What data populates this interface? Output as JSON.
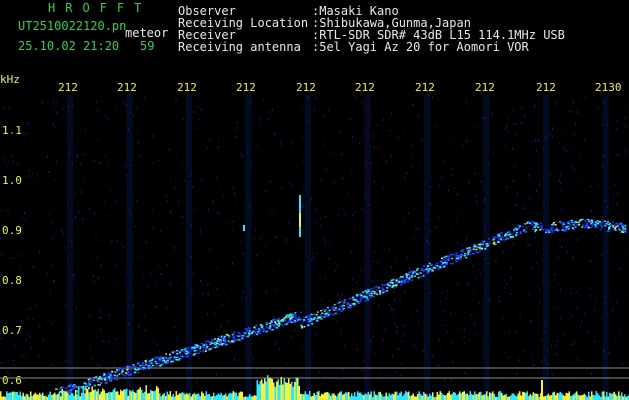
{
  "header": {
    "brand": "HROFFT",
    "filename": "UT2510022120.pn",
    "satellite_label": "meteor",
    "datetime": "25.10.02 21:20",
    "count": "59"
  },
  "meta": {
    "labels": [
      "Observer",
      "Receiving Location",
      "Receiver",
      "Receiving antenna"
    ],
    "values": [
      ":Masaki Kano",
      ":Shibukawa,Gunma,Japan",
      ":RTL-SDR SDR# 43dB L15 114.1MHz USB",
      ":5el Yagi Az 20 for Aomori VOR"
    ]
  },
  "axis": {
    "unit_label": "kHz",
    "time_ticks": [
      "212",
      "212",
      "212",
      "212",
      "212",
      "212",
      "212",
      "212",
      "212",
      "2130"
    ],
    "freq_ticks": [
      "1.1",
      "1.0",
      "0.9",
      "0.8",
      "0.7",
      "0.6"
    ]
  },
  "colors": {
    "background": "#000000",
    "label_green": "#2fd14a",
    "label_yellow": "#f2f23a",
    "signal_blue": "#1a3cff",
    "signal_cyan": "#2ee6ff",
    "signal_yellow": "#f2f23a"
  }
}
